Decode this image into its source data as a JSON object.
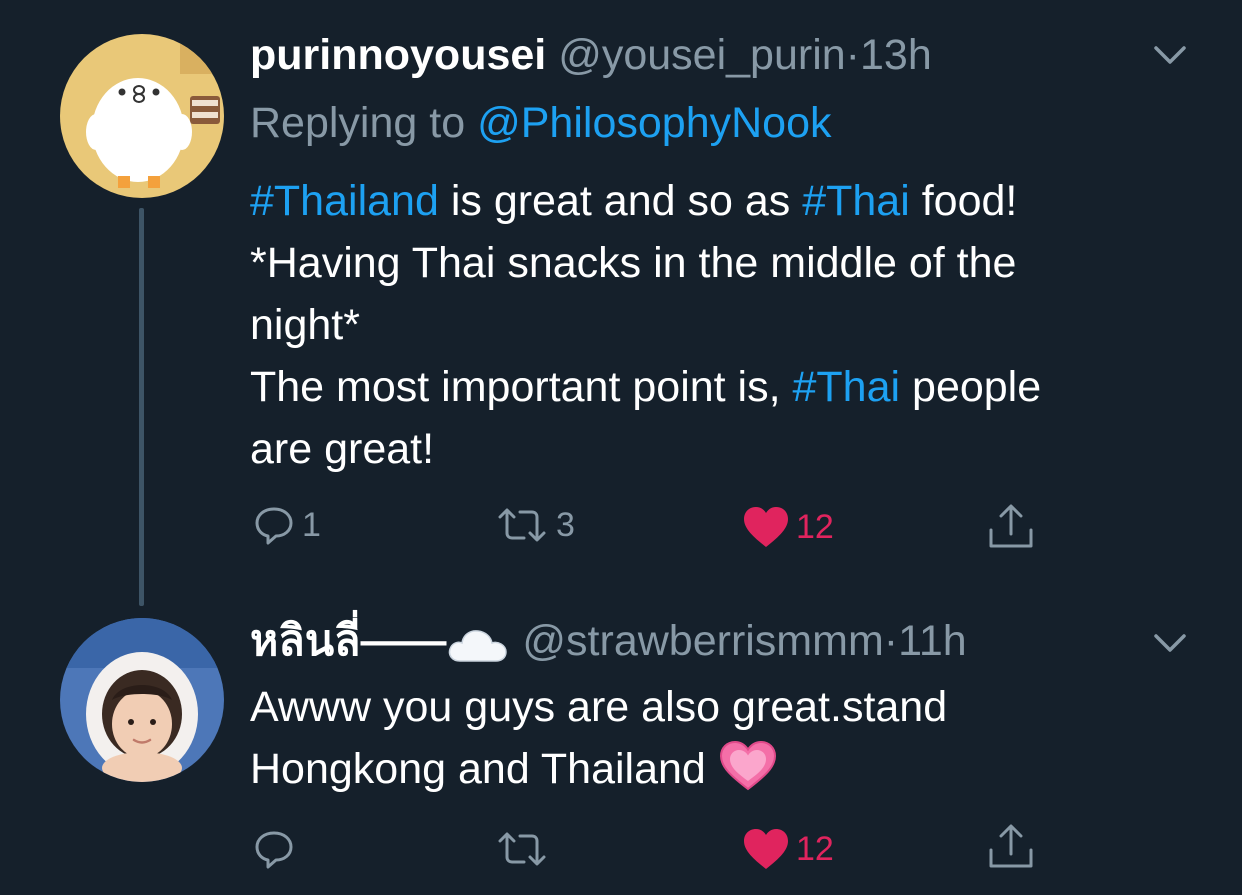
{
  "tweets": [
    {
      "display_name": "purinnoyousei",
      "handle": "@yousei_purin",
      "separator": "·",
      "time": "13h",
      "replying_prefix": "Replying to",
      "replying_to": "@PhilosophyNook",
      "body": {
        "l1_tag1": "#Thailand",
        "l1_mid": " is great and so as ",
        "l1_tag2": "#Thai",
        "l1_end": " food!",
        "l2": "*Having Thai snacks in the middle of the",
        "l3": "night*",
        "l4_start": "The most important point is, ",
        "l4_tag": "#Thai",
        "l4_end": " people",
        "l5": "are great!"
      },
      "actions": {
        "reply_count": "1",
        "retweet_count": "3",
        "like_count": "12",
        "icons": [
          "reply-icon",
          "retweet-icon",
          "heart-icon",
          "share-icon"
        ]
      }
    },
    {
      "display_name": "หลินลี่——",
      "name_emoji": "cloud-emoji",
      "handle": "@strawberrismmm",
      "separator": "·",
      "time": "11h",
      "body": {
        "l1": "Awww you guys are also great.stand",
        "l2": "Hongkong and Thailand"
      },
      "body_emoji": "pink-heart-emoji",
      "actions": {
        "like_count": "12",
        "icons": [
          "reply-icon",
          "retweet-icon",
          "heart-icon",
          "share-icon"
        ]
      }
    }
  ],
  "colors": {
    "background": "#15202b",
    "primary_text": "#ffffff",
    "secondary_text": "#8899a6",
    "link": "#1da1f2",
    "like": "#e0245e"
  }
}
